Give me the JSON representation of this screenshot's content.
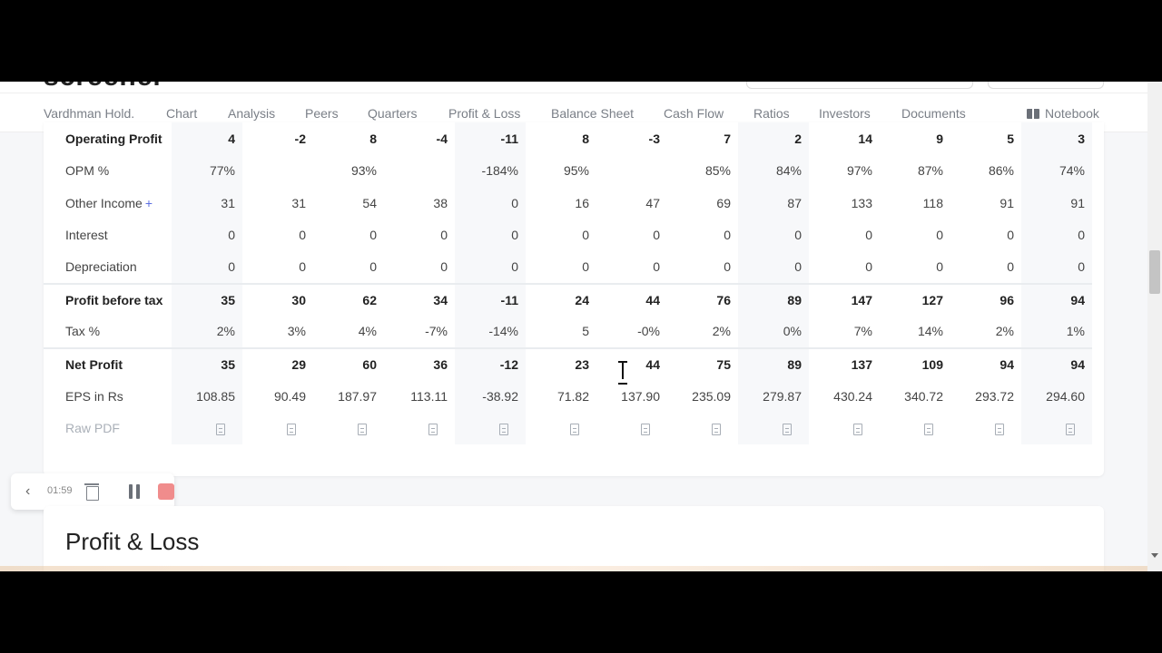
{
  "nav": {
    "items": [
      "Vardhman Hold.",
      "Chart",
      "Analysis",
      "Peers",
      "Quarters",
      "Profit & Loss",
      "Balance Sheet",
      "Cash Flow",
      "Ratios",
      "Investors",
      "Documents"
    ],
    "notebook": "Notebook"
  },
  "table": {
    "rows": [
      {
        "label": "Operating Profit",
        "values": [
          "4",
          "-2",
          "8",
          "-4",
          "-11",
          "8",
          "-3",
          "7",
          "2",
          "14",
          "9",
          "5",
          "3"
        ]
      },
      {
        "label": "OPM %",
        "values": [
          "77%",
          "",
          "93%",
          "",
          "-184%",
          "95%",
          "",
          "85%",
          "84%",
          "97%",
          "87%",
          "86%",
          "74%"
        ]
      },
      {
        "label": "Other Income",
        "plus": "+",
        "values": [
          "31",
          "31",
          "54",
          "38",
          "0",
          "16",
          "47",
          "69",
          "87",
          "133",
          "118",
          "91",
          "91"
        ]
      },
      {
        "label": "Interest",
        "values": [
          "0",
          "0",
          "0",
          "0",
          "0",
          "0",
          "0",
          "0",
          "0",
          "0",
          "0",
          "0",
          "0"
        ]
      },
      {
        "label": "Depreciation",
        "values": [
          "0",
          "0",
          "0",
          "0",
          "0",
          "0",
          "0",
          "0",
          "0",
          "0",
          "0",
          "0",
          "0"
        ]
      },
      {
        "label": "Profit before tax",
        "values": [
          "35",
          "30",
          "62",
          "34",
          "-11",
          "24",
          "44",
          "76",
          "89",
          "147",
          "127",
          "96",
          "94"
        ]
      },
      {
        "label": "Tax %",
        "values": [
          "2%",
          "3%",
          "4%",
          "-7%",
          "-14%",
          "5",
          "-0%",
          "2%",
          "0%",
          "7%",
          "14%",
          "2%",
          "1%"
        ]
      },
      {
        "label": "Net Profit",
        "values": [
          "35",
          "29",
          "60",
          "36",
          "-12",
          "23",
          "44",
          "75",
          "89",
          "137",
          "109",
          "94",
          "94"
        ]
      },
      {
        "label": "EPS in Rs",
        "values": [
          "108.85",
          "90.49",
          "187.97",
          "113.11",
          "-38.92",
          "71.82",
          "137.90",
          "235.09",
          "279.87",
          "430.24",
          "340.72",
          "293.72",
          "294.60"
        ]
      },
      {
        "label": "Raw PDF",
        "values": []
      }
    ],
    "pdf_icon": "pdf-file-icon",
    "pdf_count": 13
  },
  "recorder": {
    "time": "01:59",
    "stop_color": "#f08c8c"
  },
  "section": {
    "title": "Profit & Loss"
  }
}
